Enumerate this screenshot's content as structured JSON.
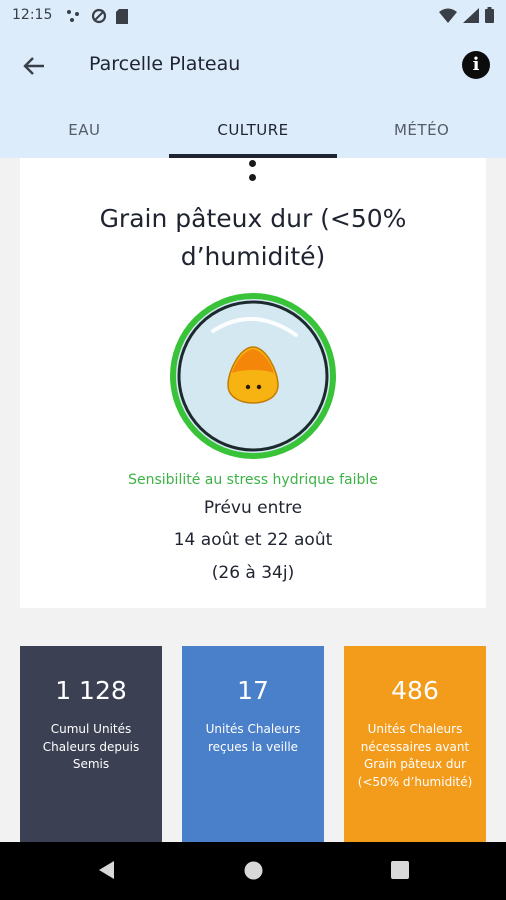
{
  "status_bar": {
    "time": "12:15",
    "left_icons": [
      "nearby-icon",
      "data-saver-icon",
      "sd-card-icon"
    ],
    "right_icons": [
      "wifi-icon",
      "signal-icon",
      "battery-icon"
    ]
  },
  "app_bar": {
    "title": "Parcelle Plateau",
    "back_icon": "arrow-left-icon",
    "info_icon": "info-icon"
  },
  "tabs": [
    {
      "label": "EAU",
      "active": false
    },
    {
      "label": "CULTURE",
      "active": true
    },
    {
      "label": "MÉTÉO",
      "active": false
    }
  ],
  "stage_card": {
    "title": "Grain pâteux dur (<50% d’humidité)",
    "sensitivity": "Sensibilité au stress hydrique faible",
    "forecast_label": "Prévu entre",
    "forecast_dates": "14 août et 22 août",
    "forecast_range": "(26 à 34j)",
    "icon": "corn-kernel-icon"
  },
  "stats": [
    {
      "value": "1 128",
      "label": "Cumul Unités Chaleurs depuis Semis"
    },
    {
      "value": "17",
      "label": "Unités Chaleurs reçues la veille"
    },
    {
      "value": "486",
      "label": "Unités Chaleurs nécessaires avant Grain pâteux dur (<50% d’humidité)"
    }
  ],
  "colors": {
    "header_bg": "#dcecfb",
    "accent_green": "#3db245",
    "stat_dark": "#3b4153",
    "stat_blue": "#4a7fc9",
    "stat_orange": "#f39b1a"
  }
}
